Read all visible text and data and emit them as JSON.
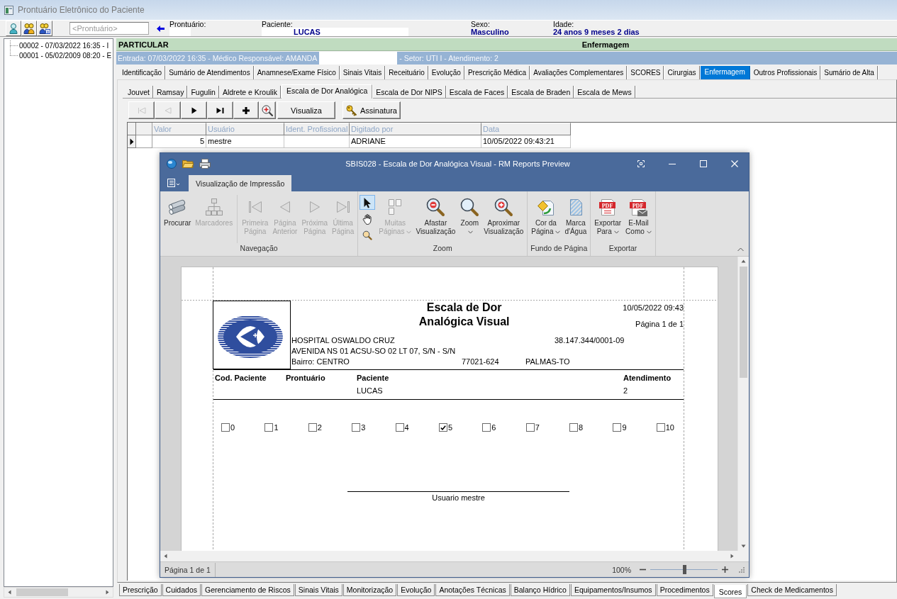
{
  "window": {
    "title": "Prontuário Eletrônico do Paciente"
  },
  "toolbar": {
    "record_field": {
      "placeholder": "<Prontuário>"
    }
  },
  "patient_info": [
    {
      "label": "Prontuário:",
      "kind": "boxed"
    },
    {
      "label": "Paciente:",
      "kind": "boxed",
      "value": "LUCAS"
    },
    {
      "label": "Sexo:",
      "kind": "plain",
      "value": "Masculino"
    },
    {
      "label": "Idade:",
      "kind": "plain",
      "value": "24 anos 9 meses 2 dias"
    }
  ],
  "visits_tree": {
    "items": [
      {
        "label": "00002 - 07/03/2022 16:35 - I"
      },
      {
        "label": "00001 - 05/02/2009 08:20 - E"
      }
    ]
  },
  "summary_bar": {
    "category": "PARTICULAR",
    "section": "Enfermagem"
  },
  "admission_bar": {
    "entry": "Entrada: 07/03/2022 16:35 - Médico Responsável: AMANDA",
    "details": "- Setor: UTI I - Atendimento: 2"
  },
  "main_tabs": [
    {
      "label": "Identificação",
      "selected": false
    },
    {
      "label": "Sumário de Atendimentos",
      "selected": false
    },
    {
      "label": "Anamnese/Exame Físico",
      "selected": false
    },
    {
      "label": "Sinais Vitais",
      "selected": false
    },
    {
      "label": "Receituário",
      "selected": false
    },
    {
      "label": "Evolução",
      "selected": false
    },
    {
      "label": "Prescrição Médica",
      "selected": false
    },
    {
      "label": "Avaliações Complementares",
      "selected": false
    },
    {
      "label": "SCORES",
      "selected": false
    },
    {
      "label": "Cirurgias",
      "selected": false
    },
    {
      "label": "Enfermagem",
      "selected": true
    },
    {
      "label": "Outros Profissionais",
      "selected": false
    },
    {
      "label": "Sumário de Alta",
      "selected": false
    }
  ],
  "score_tabs": [
    {
      "label": "Jouvet",
      "selected": false
    },
    {
      "label": "Ramsay",
      "selected": false
    },
    {
      "label": "Fugulin",
      "selected": false
    },
    {
      "label": "Aldrete e Kroulik",
      "selected": false
    },
    {
      "label": "Escala de Dor Analógica",
      "selected": true
    },
    {
      "label": "Escala de Dor NIPS",
      "selected": false
    },
    {
      "label": "Escala de Faces",
      "selected": false
    },
    {
      "label": "Escala de Braden",
      "selected": false
    },
    {
      "label": "Escala de Mews",
      "selected": false
    }
  ],
  "record_toolbar": [
    {
      "kind": "first",
      "disabled": true
    },
    {
      "kind": "previous",
      "disabled": true
    },
    {
      "kind": "next",
      "disabled": false
    },
    {
      "kind": "last",
      "disabled": false
    },
    {
      "kind": "add",
      "disabled": false
    },
    {
      "kind": "zoom",
      "disabled": false
    },
    {
      "kind": "view",
      "label": "Visualiza",
      "disabled": false
    },
    {
      "kind": "signature",
      "label": "Assinatura",
      "disabled": false
    }
  ],
  "records_grid": {
    "columns": [
      "Valor",
      "Usuário",
      "Ident. Profissional",
      "Digitado por",
      "Data"
    ],
    "rows": [
      {
        "selected": true,
        "cells": {
          "valor": "5",
          "usuario": "mestre",
          "digitado_por": "ADRIANE",
          "data": "10/05/2022 09:43:21"
        }
      }
    ]
  },
  "report_preview": {
    "title": "SBIS028 - Escala de Dor Analógica Visual - RM Reports Preview",
    "ribbon_tabs": [
      {
        "label": "Visualização de Impressão",
        "selected": true
      }
    ],
    "ribbon_groups": [
      {
        "title": "Navegação",
        "items": [
          {
            "kind": "search",
            "label": [
              "Procurar"
            ],
            "disabled": false,
            "dropdown": false
          },
          {
            "kind": "bookmarks",
            "label": [
              "Marcadores"
            ],
            "disabled": true,
            "dropdown": false
          },
          {
            "kind": "separator"
          },
          {
            "kind": "first",
            "label": [
              "Primeira",
              "Página"
            ],
            "disabled": true,
            "dropdown": false
          },
          {
            "kind": "previous",
            "label": [
              "Página",
              "Anterior"
            ],
            "disabled": true,
            "dropdown": false
          },
          {
            "kind": "next",
            "label": [
              "Próxima",
              "Página"
            ],
            "disabled": true,
            "dropdown": false
          },
          {
            "kind": "last",
            "label": [
              "Última",
              "Página"
            ],
            "disabled": true,
            "dropdown": false
          }
        ]
      },
      {
        "title": "Zoom",
        "items": [
          {
            "kind": "tools",
            "tools": [
              {
                "kind": "pointer",
                "selected": true
              },
              {
                "kind": "hand",
                "selected": false
              },
              {
                "kind": "magnifier",
                "selected": false
              }
            ]
          },
          {
            "kind": "pages",
            "label": [
              "Muitas",
              "Páginas"
            ],
            "disabled": true,
            "dropdown": true
          },
          {
            "kind": "zoomout",
            "label": [
              "Afastar",
              "Visualização"
            ],
            "disabled": false,
            "dropdown": false
          },
          {
            "kind": "zoom",
            "label": [
              "Zoom"
            ],
            "disabled": false,
            "dropdown": true
          },
          {
            "kind": "zoomin",
            "label": [
              "Aproximar",
              "Visualização"
            ],
            "disabled": false,
            "dropdown": false
          }
        ]
      },
      {
        "title": "Fundo de Página",
        "items": [
          {
            "kind": "pagecolor",
            "label": [
              "Cor da",
              "Página"
            ],
            "disabled": false,
            "dropdown": true
          },
          {
            "kind": "watermark",
            "label": [
              "Marca",
              "d'Água"
            ],
            "disabled": false,
            "dropdown": false
          }
        ]
      },
      {
        "title": "Exportar",
        "items": [
          {
            "kind": "export",
            "label": [
              "Exportar",
              "Para"
            ],
            "disabled": false,
            "dropdown": true,
            "badge": "PDF"
          },
          {
            "kind": "email",
            "label": [
              "E-Mail",
              "Como"
            ],
            "disabled": false,
            "dropdown": true,
            "badge": "PDF"
          }
        ]
      }
    ],
    "report": {
      "title": [
        "Escala de Dor",
        "Analógica Visual"
      ],
      "printed_at": "10/05/2022 09:43",
      "page": "Página 1 de 1",
      "hospital": {
        "name": "HOSPITAL OSWALDO CRUZ",
        "cnpj": "38.147.344/0001-09",
        "address": "AVENIDA NS 01 ACSU-SO 02 LT 07, S/N - S/N",
        "district": "Bairro: CENTRO",
        "zip": "77021-624",
        "city": "PALMAS-TO"
      },
      "patient_table": {
        "columns": [
          "Cod. Paciente",
          "Prontuário",
          "Paciente",
          "Atendimento"
        ],
        "values": {
          "paciente": "LUCAS",
          "atendimento": "2"
        }
      },
      "pain_scale": [
        {
          "label": "0",
          "checked": false
        },
        {
          "label": "1",
          "checked": false
        },
        {
          "label": "2",
          "checked": false
        },
        {
          "label": "3",
          "checked": false
        },
        {
          "label": "4",
          "checked": false
        },
        {
          "label": "5",
          "checked": true
        },
        {
          "label": "6",
          "checked": false
        },
        {
          "label": "7",
          "checked": false
        },
        {
          "label": "8",
          "checked": false
        },
        {
          "label": "9",
          "checked": false
        },
        {
          "label": "10",
          "checked": false
        }
      ],
      "signature": "Usuario mestre"
    },
    "status_bar": {
      "page": "Página 1 de 1",
      "zoom": "100%",
      "zoom_slider": {
        "level": 0.5
      }
    }
  },
  "bottom_tabs": [
    {
      "label": "Prescrição",
      "selected": false
    },
    {
      "label": "Cuidados",
      "selected": false
    },
    {
      "label": "Gerenciamento de Riscos",
      "selected": false
    },
    {
      "label": "Sinais Vitais",
      "selected": false
    },
    {
      "label": "Monitorização",
      "selected": false
    },
    {
      "label": "Evolução",
      "selected": false
    },
    {
      "label": "Anotações Técnicas",
      "selected": false
    },
    {
      "label": "Balanço Hídrico",
      "selected": false
    },
    {
      "label": "Equipamentos/Insumos",
      "selected": false
    },
    {
      "label": "Procedimentos",
      "selected": false
    },
    {
      "label": "Scores",
      "selected": true
    },
    {
      "label": "Check de Medicamentos",
      "selected": false
    }
  ]
}
